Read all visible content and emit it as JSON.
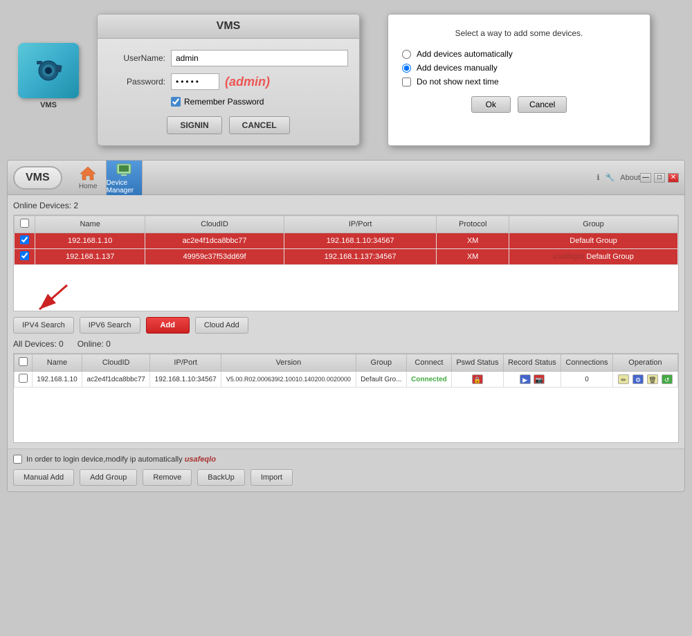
{
  "top_section": {
    "vms_icon": {
      "label": "VMS"
    },
    "login_dialog": {
      "title": "VMS",
      "username_label": "UserName:",
      "username_value": "admin",
      "password_label": "Password:",
      "password_dots": "•••••",
      "password_hint": "(admin)",
      "remember_label": "Remember Password",
      "signin_btn": "SIGNIN",
      "cancel_btn": "CANCEL"
    },
    "add_device_dialog": {
      "title": "Select a way to add some devices.",
      "option1_label": "Add devices automatically",
      "option2_label": "Add devices manually",
      "checkbox_label": "Do not show next time",
      "ok_btn": "Ok",
      "cancel_btn": "Cancel"
    }
  },
  "app": {
    "logo": "VMS",
    "nav": {
      "home_label": "Home",
      "device_manager_label": "Device Manager"
    },
    "topbar_right": {
      "about_label": "About"
    },
    "online_devices": {
      "section_label": "Online Devices:  2",
      "columns": [
        "",
        "Name",
        "CloudID",
        "IP/Port",
        "Protocol",
        "Group"
      ],
      "rows": [
        {
          "name": "192.168.1.10",
          "cloud_id": "ac2e4f1dca8bbc77",
          "ip_port": "192.168.1.10:34567",
          "protocol": "XM",
          "group": "Default Group",
          "selected": true
        },
        {
          "name": "192.168.1.137",
          "cloud_id": "49959c37f53dd69f",
          "ip_port": "192.168.1.137:34567",
          "protocol": "XM",
          "group": "usafeqlo Default Group",
          "selected": true
        }
      ]
    },
    "search_buttons": {
      "ipv4_search": "IPV4 Search",
      "ipv6_search": "IPV6 Search",
      "add": "Add",
      "cloud_add": "Cloud Add"
    },
    "all_devices": {
      "section_label": "All Devices:  0",
      "online_label": "Online:  0",
      "columns": [
        "",
        "Name",
        "CloudID",
        "IP/Port",
        "Version",
        "Group",
        "Connect",
        "Pswd Status",
        "Record Status",
        "Connections",
        "Operation"
      ],
      "rows": [
        {
          "name": "192.168.1.10",
          "cloud_id": "ac2e4f1dca8bbc77",
          "ip_port": "192.168.1.10:34567",
          "version": "V5.00.R02.000639I2.10010.140200.0020000",
          "group": "Default Gro...",
          "connect": "Connected",
          "connections": "0"
        }
      ]
    },
    "bottom": {
      "checkbox_label": "In order to login device,modify ip automatically",
      "watermark": "usafeqlo",
      "manual_add_btn": "Manual Add",
      "add_group_btn": "Add Group",
      "remove_btn": "Remove",
      "backup_btn": "BackUp",
      "import_btn": "Import"
    }
  }
}
